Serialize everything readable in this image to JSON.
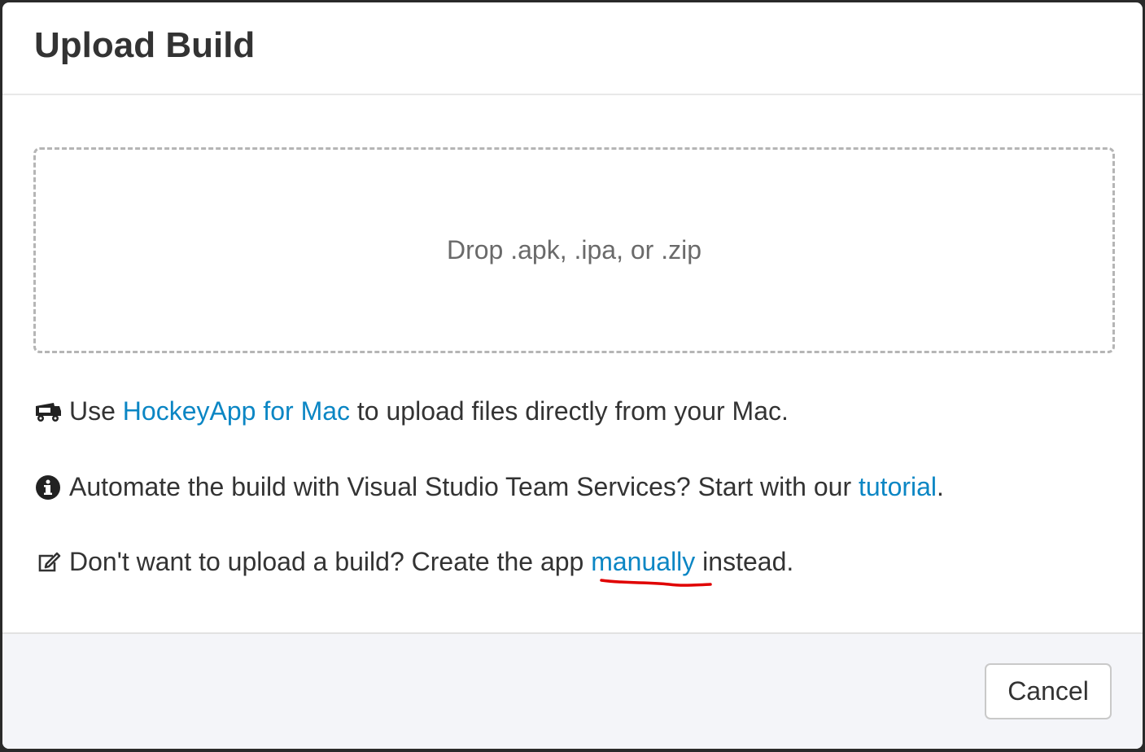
{
  "modal": {
    "title": "Upload Build"
  },
  "dropzone": {
    "text": "Drop .apk, .ipa, or .zip"
  },
  "info": {
    "mac": {
      "prefix": "Use ",
      "link": "HockeyApp for Mac",
      "suffix": " to upload files directly from your Mac."
    },
    "automate": {
      "prefix": "Automate the build with Visual Studio Team Services? Start with our ",
      "link": "tutorial",
      "suffix": "."
    },
    "manual": {
      "prefix": "Don't want to upload a build? Create the app ",
      "link": "manually",
      "suffix": " instead."
    }
  },
  "footer": {
    "cancel_label": "Cancel"
  },
  "icons": {
    "mac": "truck-icon",
    "automate": "info-circle-icon",
    "manual": "edit-icon"
  },
  "colors": {
    "link": "#0b86c4",
    "annotation": "#e00000"
  }
}
